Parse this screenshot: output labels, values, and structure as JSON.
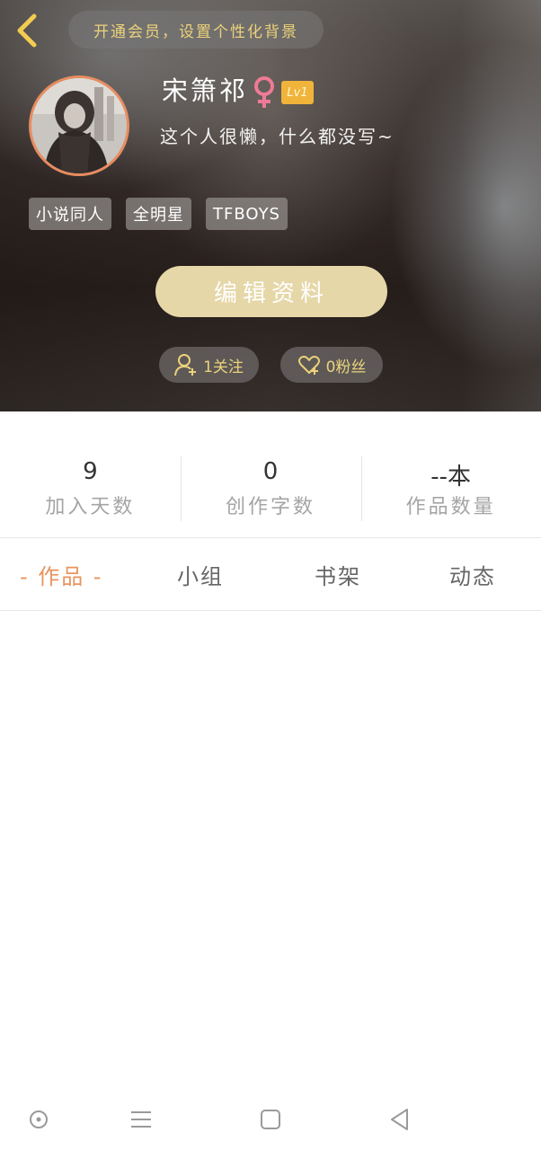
{
  "header": {
    "vip_banner": "开通会员，设置个性化背景",
    "icons": {
      "back": "back-chevron-icon",
      "gender": "female-icon"
    }
  },
  "profile": {
    "username": "宋箫祁",
    "level": "Lv1",
    "bio": "这个人很懒，什么都没写~",
    "tags": [
      "小说同人",
      "全明星",
      "TFBOYS"
    ],
    "edit_label": "编辑资料",
    "following_label": "1关注",
    "fans_label": "0粉丝"
  },
  "stats": [
    {
      "value": "9",
      "label": "加入天数"
    },
    {
      "value": "0",
      "label": "创作字数"
    },
    {
      "value": "--本",
      "label": "作品数量"
    }
  ],
  "tabs": {
    "active": "- 作品 -",
    "items": [
      "小组",
      "书架",
      "动态"
    ]
  },
  "nav": {
    "icons": [
      "circle-icon",
      "menu-icon",
      "square-icon",
      "back-triangle-icon"
    ]
  },
  "colors": {
    "accent": "#e8945f",
    "gold": "#ecd27a",
    "edit_button": "#e6d7a8",
    "level_badge": "#f0b43a"
  }
}
